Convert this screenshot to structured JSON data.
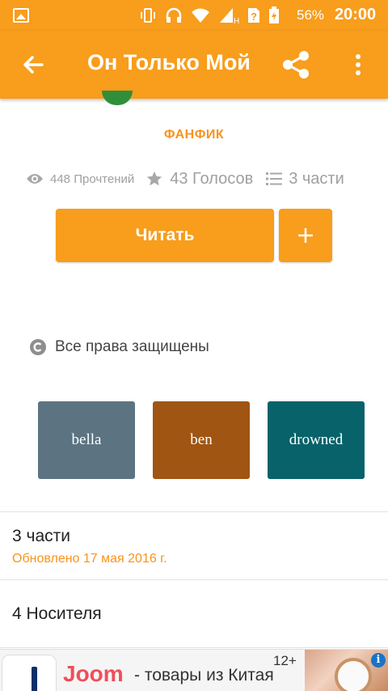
{
  "status_bar": {
    "battery_percent": "56%",
    "time": "20:00",
    "network_label": "H",
    "icons": [
      "gallery-icon",
      "vibrate-icon",
      "headphones-icon",
      "wifi-icon",
      "signal-icon",
      "sim-question-icon",
      "battery-icon"
    ]
  },
  "app_bar": {
    "title": "Он Только Мой",
    "back_icon": "arrow-left-icon",
    "share_icon": "share-icon",
    "menu_icon": "more-vert-icon"
  },
  "story": {
    "genre": "ФАНФИК",
    "reads": "448 Прочтений",
    "votes": "43 Голосов",
    "parts": "3 части",
    "read_button": "Читать",
    "add_button": "+",
    "copyright": "Все права защищены"
  },
  "tags": [
    {
      "label": "bella",
      "color": "#5c7482"
    },
    {
      "label": "ben",
      "color": "#a05512"
    },
    {
      "label": "drowned",
      "color": "#07626a"
    }
  ],
  "sections": {
    "parts_title": "3 части",
    "parts_updated": "Обновлено 17 мая 2016 г.",
    "media_title": "4 Носителя"
  },
  "ad": {
    "brand": "Joom",
    "tagline": "- товары из Китая",
    "age_rating": "12+",
    "info_icon": "i"
  },
  "colors": {
    "accent": "#f89d1c",
    "accent_text": "#f7941d"
  }
}
